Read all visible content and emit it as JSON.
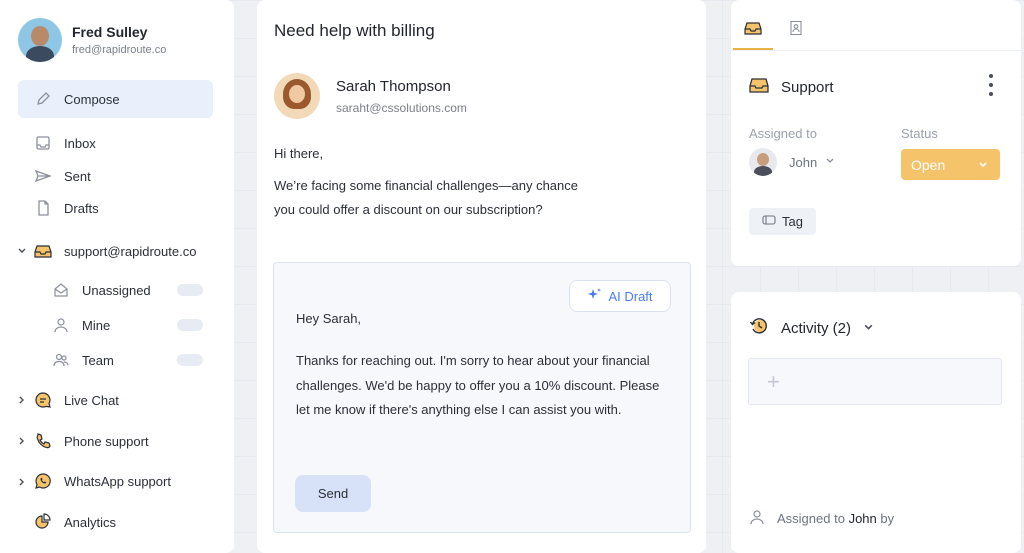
{
  "user": {
    "name": "Fred Sulley",
    "email": "fred@rapidroute.co"
  },
  "compose_label": "Compose",
  "nav": {
    "inbox": "Inbox",
    "sent": "Sent",
    "drafts": "Drafts"
  },
  "mailbox": {
    "name": "support@rapidroute.co",
    "items": [
      "Unassigned",
      "Mine",
      "Team"
    ]
  },
  "channels": {
    "live_chat": "Live Chat",
    "phone": "Phone support",
    "whatsapp": "WhatsApp support",
    "analytics": "Analytics"
  },
  "conversation": {
    "subject": "Need help with billing",
    "sender_name": "Sarah Thompson",
    "sender_email": "saraht@cssolutions.com",
    "greeting": "Hi there,",
    "body_line1": "We’re facing some financial challenges—any chance",
    "body_line2": "you could offer a discount on our subscription?"
  },
  "draft": {
    "ai_label": "AI Draft",
    "greeting": "Hey Sarah,",
    "body": "Thanks for reaching out. I'm sorry to hear about your financial challenges. We'd be happy to offer you a 10% discount. Please let me know if there's anything else I can assist you with.",
    "send_label": "Send"
  },
  "details": {
    "inbox_name": "Support",
    "assigned_label": "Assigned to",
    "assignee": "John",
    "status_label": "Status",
    "status_value": "Open",
    "tag_label": "Tag"
  },
  "activity": {
    "title": "Activity (2)",
    "add_symbol": "+",
    "assigned_prefix": "Assigned to",
    "assigned_name": "John",
    "assigned_suffix": "by"
  },
  "colors": {
    "accent": "#f5c36a",
    "compose_bg": "#eaf0fb",
    "ai_blue": "#4a7ce8"
  }
}
